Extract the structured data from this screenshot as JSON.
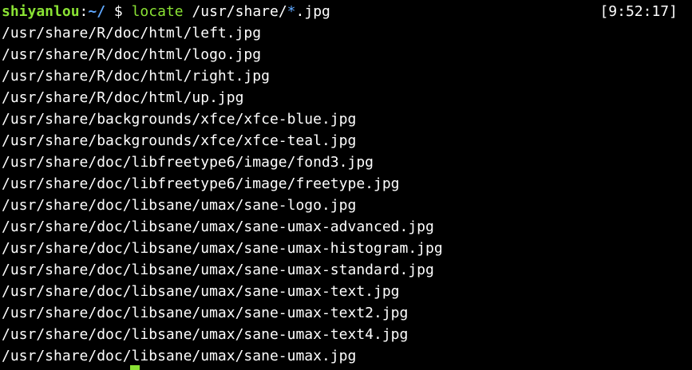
{
  "prompt": {
    "user": "shiyanlou",
    "separator": ":",
    "cwd": "~/",
    "dollar": " $ ",
    "command": "locate",
    "arg_prefix": " /usr/share/",
    "glob": "*",
    "arg_suffix": ".jpg",
    "time": "[9:52:17]"
  },
  "output_lines": [
    "/usr/share/R/doc/html/left.jpg",
    "/usr/share/R/doc/html/logo.jpg",
    "/usr/share/R/doc/html/right.jpg",
    "/usr/share/R/doc/html/up.jpg",
    "/usr/share/backgrounds/xfce/xfce-blue.jpg",
    "/usr/share/backgrounds/xfce/xfce-teal.jpg",
    "/usr/share/doc/libfreetype6/image/fond3.jpg",
    "/usr/share/doc/libfreetype6/image/freetype.jpg",
    "/usr/share/doc/libsane/umax/sane-logo.jpg",
    "/usr/share/doc/libsane/umax/sane-umax-advanced.jpg",
    "/usr/share/doc/libsane/umax/sane-umax-histogram.jpg",
    "/usr/share/doc/libsane/umax/sane-umax-standard.jpg",
    "/usr/share/doc/libsane/umax/sane-umax-text.jpg",
    "/usr/share/doc/libsane/umax/sane-umax-text2.jpg",
    "/usr/share/doc/libsane/umax/sane-umax-text4.jpg",
    "/usr/share/doc/libsane/umax/sane-umax.jpg"
  ],
  "colors": {
    "background": "#000000",
    "user": "#8ae234",
    "cwd": "#5fa8ff",
    "command": "#8ae234",
    "text": "#ffffff"
  }
}
